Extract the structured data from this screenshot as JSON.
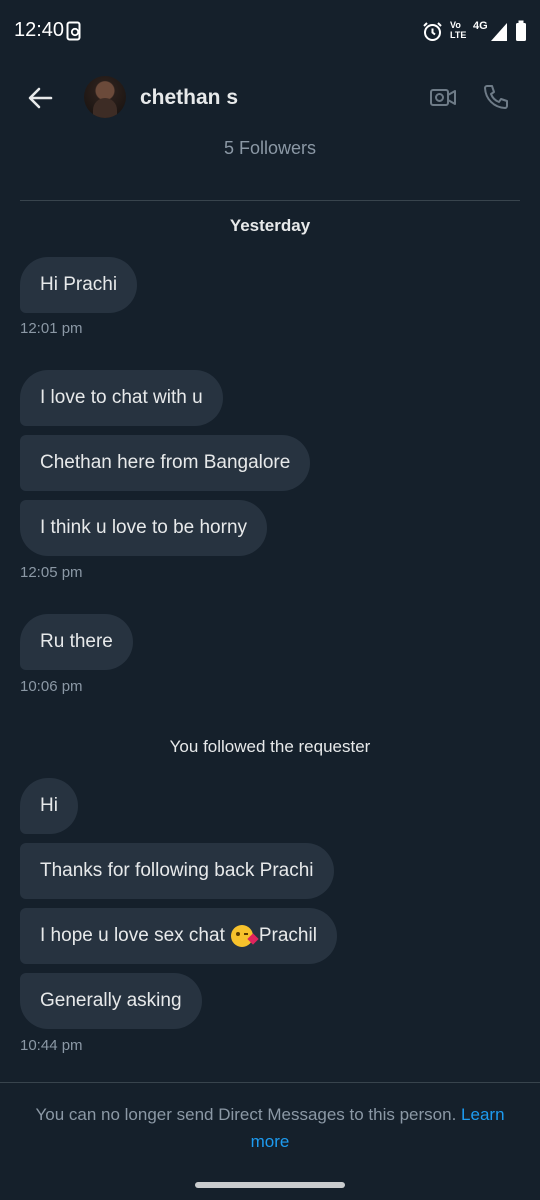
{
  "status_bar": {
    "time": "12:40",
    "network": "4G",
    "volte": "Vo LTE",
    "icons": [
      "screen-record-icon",
      "alarm-icon",
      "volte-icon",
      "signal-icon",
      "battery-icon"
    ]
  },
  "header": {
    "contact_name": "chethan s",
    "followers": "5 Followers",
    "icons": [
      "back-arrow-icon",
      "video-call-icon",
      "phone-call-icon"
    ]
  },
  "conversation": {
    "date_separator": "Yesterday",
    "groups": [
      {
        "messages": [
          "Hi Prachi"
        ],
        "time": "12:01 pm"
      },
      {
        "messages": [
          "I love to chat with u",
          "Chethan here from Bangalore",
          "I think u love to be horny"
        ],
        "time": "12:05 pm"
      },
      {
        "messages": [
          "Ru there"
        ],
        "time": "10:06 pm"
      }
    ],
    "system_note": "You followed the requester",
    "groups2": [
      {
        "messages": [
          "Hi",
          "Thanks for following back Prachi",
          "I hope u love sex chat",
          "Generally asking"
        ],
        "time": "10:44 pm"
      }
    ],
    "emoji_suffix": "Prachil",
    "emoji_name": "face-blowing-kiss"
  },
  "footer": {
    "notice": "You can no longer send Direct Messages to this person.",
    "link_label_1": "Learn",
    "link_label_2": "more"
  },
  "colors": {
    "background": "#15202b",
    "bubble": "#273340",
    "text": "#e7e9ea",
    "muted": "#8b98a5",
    "link": "#1d9bf0",
    "divider": "#38444d"
  }
}
